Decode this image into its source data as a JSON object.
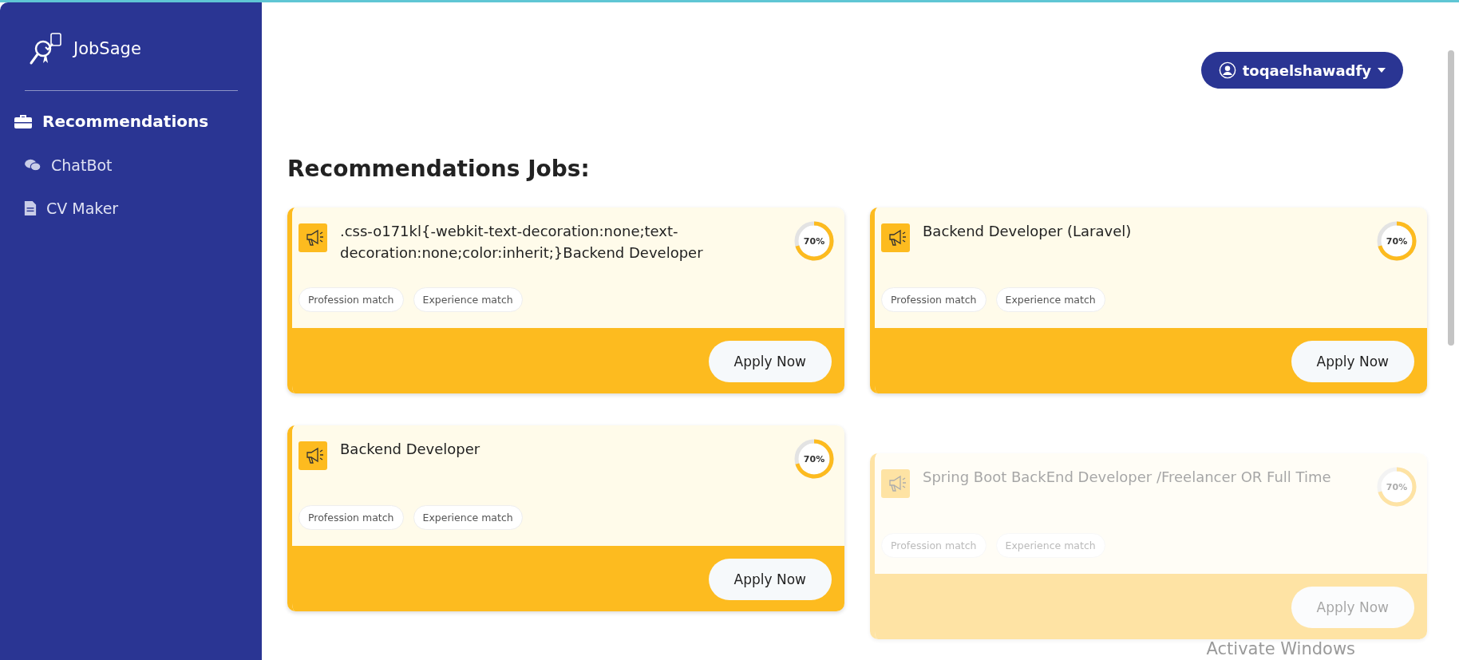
{
  "sidebar": {
    "brand": "JobSage",
    "items": [
      {
        "label": "Recommendations",
        "kind": "briefcase",
        "selected": true
      },
      {
        "label": "ChatBot",
        "kind": "chat",
        "selected": false
      },
      {
        "label": "CV Maker",
        "kind": "document",
        "selected": false
      }
    ]
  },
  "user_menu": {
    "label": "toqaelshawadfy"
  },
  "heading": "Recommendations Jobs:",
  "jobs": [
    {
      "title": ".css-o171kl{-webkit-text-decoration:none;text-decoration:none;color:inherit;}Backend Developer",
      "match": "70%",
      "level": 0.7,
      "tags": [
        "Profession match",
        "Experience match"
      ],
      "button": "Apply Now",
      "faded": false
    },
    {
      "title": "Backend Developer (Laravel)",
      "match": "70%",
      "level": 0.7,
      "tags": [
        "Profession match",
        "Experience match"
      ],
      "button": "Apply Now",
      "faded": false
    },
    {
      "title": "Backend Developer",
      "match": "70%",
      "level": 0.7,
      "tags": [
        "Profession match",
        "Experience match"
      ],
      "button": "Apply Now",
      "faded": false
    },
    {
      "title": "Spring Boot BackEnd Developer /Freelancer OR Full Time",
      "match": "70%",
      "level": 0.7,
      "tags": [
        "Profession match",
        "Experience match"
      ],
      "button": "Apply Now",
      "faded": true
    }
  ],
  "system_notice": "Activate Windows"
}
